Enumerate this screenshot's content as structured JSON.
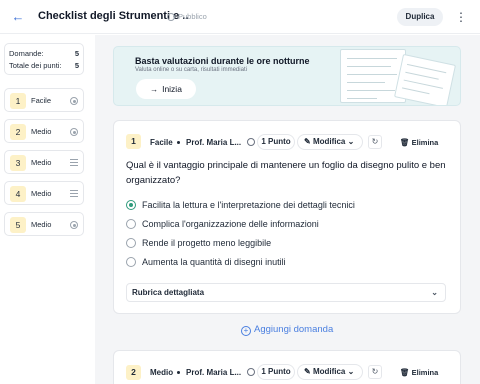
{
  "header": {
    "title": "Checklist degli Strumenti e ..",
    "visibility": "Pubblico",
    "duplicate_label": "Duplica"
  },
  "stats": {
    "questions_label": "Domande:",
    "questions_value": "5",
    "points_label": "Totale dei punti:",
    "points_value": "5"
  },
  "sidebar": {
    "items": [
      {
        "num": "1",
        "label": "Facile",
        "icon": "radio-icon"
      },
      {
        "num": "2",
        "label": "Medio",
        "icon": "radio-icon"
      },
      {
        "num": "3",
        "label": "Medio",
        "icon": "lines-icon"
      },
      {
        "num": "4",
        "label": "Medio",
        "icon": "lines-icon"
      },
      {
        "num": "5",
        "label": "Medio",
        "icon": "radio-icon"
      }
    ]
  },
  "banner": {
    "title": "Basta valutazioni durante le ore notturne",
    "subtitle": "Valuta online o su carta, risultati immediati",
    "start_label": "Inizia"
  },
  "question1": {
    "number": "1",
    "difficulty": "Facile",
    "author": "Prof. Maria L...",
    "points": "1 Punto",
    "edit_label": "Modifica",
    "delete_label": "Elimina",
    "text": "Qual è il vantaggio principale di mantenere un foglio da disegno pulito e ben organizzato?",
    "options": [
      "Facilita la lettura e l'interpretazione dei dettagli tecnici",
      "Complica l'organizzazione delle informazioni",
      "Rende il progetto meno leggibile",
      "Aumenta la quantità di disegni inutili"
    ],
    "selected_option": 0,
    "rubric_label": "Rubrica dettagliata"
  },
  "add_question_label": "Aggiungi domanda",
  "question2": {
    "number": "2",
    "difficulty": "Medio",
    "author": "Prof. Maria L...",
    "points": "1 Punto",
    "edit_label": "Modifica",
    "delete_label": "Elimina"
  },
  "colors": {
    "accent": "#4a7fe0",
    "badge_bg": "#fdf1c7",
    "selected_radio": "#2f9b7c",
    "banner_bg": "#e6f3f4"
  }
}
